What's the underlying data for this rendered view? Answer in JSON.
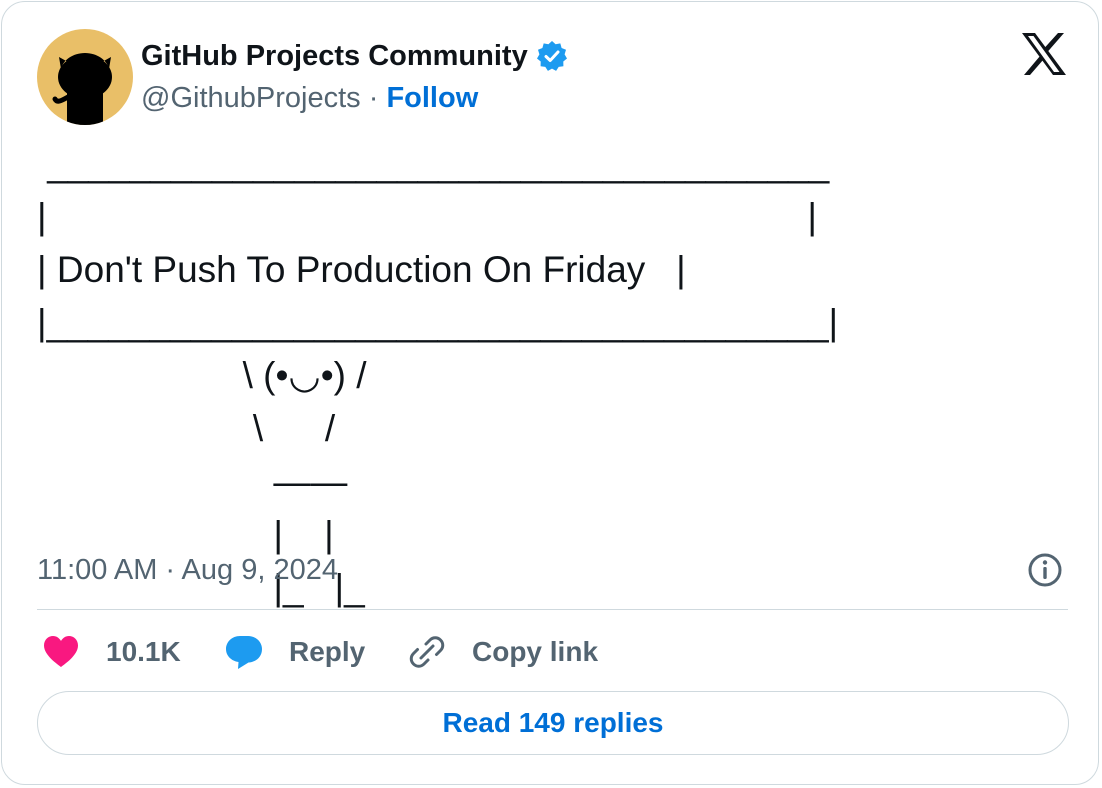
{
  "author": {
    "name": "GitHub Projects Community",
    "handle": "@GithubProjects",
    "separator": "·",
    "follow_label": "Follow",
    "verified": true
  },
  "icons": {
    "avatar": "octocat-icon",
    "verified": "verified-badge-icon",
    "logo": "x-logo-icon",
    "info": "info-icon",
    "like": "heart-icon",
    "reply": "speech-bubble-icon",
    "copy": "link-icon"
  },
  "tweet": {
    "text": " ______________________________________\n|                                                                          |\n| Don't Push To Production On Friday   |\n|______________________________________|\n                    \\ (•◡•) /\n                     \\      /\n                       ——\n                       |    |\n                       |_   |_"
  },
  "meta": {
    "timestamp": "11:00 AM · Aug 9, 2024"
  },
  "actions": {
    "like_count": "10.1K",
    "reply_label": "Reply",
    "copy_label": "Copy link"
  },
  "footer": {
    "read_replies_label": "Read 149 replies"
  },
  "colors": {
    "link": "#006fd6",
    "like": "#f91880",
    "reply": "#1d9bf0",
    "verified": "#1d9bf0",
    "avatar_bg": "#e9bf68",
    "border": "#cfd9de",
    "muted_text": "#536471"
  }
}
